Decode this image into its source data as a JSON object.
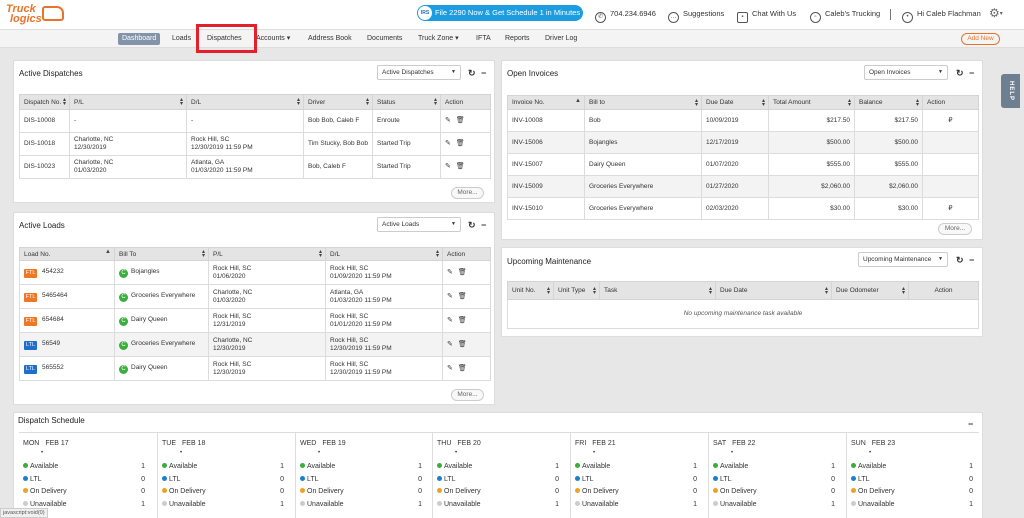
{
  "header": {
    "logo_line1": "Truck",
    "logo_line2": "logics",
    "promo": "File 2290 Now & Get Schedule 1 in Minutes",
    "promo_badge": "IRS",
    "phone": "704.234.6946",
    "suggestions": "Suggestions",
    "chat": "Chat With Us",
    "company": "Caleb's Trucking",
    "greeting": "Hi Caleb Flachman"
  },
  "nav": {
    "items": [
      "Dashboard",
      "Loads",
      "Dispatches",
      "Accounts",
      "Address Book",
      "Documents",
      "Truck Zone",
      "IFTA",
      "Reports",
      "Driver Log"
    ],
    "add_new": "Add New"
  },
  "help_tab": "HELP",
  "active_dispatches": {
    "title": "Active Dispatches",
    "select": "Active Dispatches",
    "more": "More...",
    "columns": [
      "Dispatch No.",
      "P/L",
      "D/L",
      "Driver",
      "Status",
      "Action"
    ],
    "rows": [
      [
        "DIS-10008",
        "-",
        "",
        "-",
        "",
        "Bob Bob, Caleb F",
        "Enroute"
      ],
      [
        "DIS-10018",
        "Charlotte, NC",
        "12/30/2019",
        "Rock Hill, SC",
        "12/30/2019 11:59 PM",
        "Tim Stucky, Bob Bob",
        "Started Trip"
      ],
      [
        "DIS-10023",
        "Charlotte, NC",
        "01/03/2020",
        "Atlanta, GA",
        "01/03/2020 11:59 PM",
        "Bob, Caleb F",
        "Started Trip"
      ]
    ]
  },
  "active_loads": {
    "title": "Active Loads",
    "select": "Active Loads",
    "more": "More...",
    "columns": [
      "Load No.",
      "Bill To",
      "P/L",
      "D/L",
      "Action"
    ],
    "rows": [
      [
        "FTL",
        "454232",
        "Bojangles",
        "Rock Hill, SC",
        "01/06/2020",
        "Rock Hill, SC",
        "01/09/2020 11:59 PM"
      ],
      [
        "FTL",
        "5465464",
        "Groceries Everywhere",
        "Charlotte, NC",
        "01/03/2020",
        "Atlanta, GA",
        "01/03/2020 11:59 PM"
      ],
      [
        "FTL",
        "654684",
        "Dairy Queen",
        "Rock Hill, SC",
        "12/31/2019",
        "Rock Hill, SC",
        "01/01/2020 11:59 PM"
      ],
      [
        "LTL",
        "56549",
        "Groceries Everywhere",
        "Charlotte, NC",
        "12/30/2019",
        "Rock Hill, SC",
        "12/30/2019 11:59 PM"
      ],
      [
        "LTL",
        "565552",
        "Dairy Queen",
        "Rock Hill, SC",
        "12/30/2019",
        "Rock Hill, SC",
        "12/30/2019 11:59 PM"
      ]
    ]
  },
  "open_invoices": {
    "title": "Open Invoices",
    "select": "Open Invoices",
    "more": "More...",
    "columns": [
      "Invoice No.",
      "Bill to",
      "Due Date",
      "Total Amount",
      "Balance",
      "Action"
    ],
    "rows": [
      [
        "INV-10008",
        "Bob",
        "10/09/2019",
        "$217.50",
        "$217.50"
      ],
      [
        "INV-15006",
        "Bojangles",
        "12/17/2019",
        "$500.00",
        "$500.00"
      ],
      [
        "INV-15007",
        "Dairy Queen",
        "01/07/2020",
        "$555.00",
        "$555.00"
      ],
      [
        "INV-15009",
        "Groceries Everywhere",
        "01/27/2020",
        "$2,060.00",
        "$2,060.00"
      ],
      [
        "INV-15010",
        "Groceries Everywhere",
        "02/03/2020",
        "$30.00",
        "$30.00"
      ]
    ]
  },
  "maintenance": {
    "title": "Upcoming Maintenance",
    "select": "Upcoming Maintenance",
    "columns": [
      "Unit No.",
      "Unit Type",
      "Task",
      "Due Date",
      "Due Odometer",
      "Action"
    ],
    "empty": "No upcoming maintenance task available"
  },
  "schedule": {
    "title": "Dispatch Schedule",
    "labels": [
      "Available",
      "LTL",
      "On Delivery",
      "Unavailable"
    ],
    "days": [
      {
        "dow": "MON",
        "date": "FEB 17",
        "values": [
          "1",
          "0",
          "0",
          "1"
        ]
      },
      {
        "dow": "TUE",
        "date": "FEB 18",
        "values": [
          "1",
          "0",
          "0",
          "1"
        ]
      },
      {
        "dow": "WED",
        "date": "FEB 19",
        "values": [
          "1",
          "0",
          "0",
          "1"
        ]
      },
      {
        "dow": "THU",
        "date": "FEB 20",
        "values": [
          "1",
          "0",
          "0",
          "1"
        ]
      },
      {
        "dow": "FRI",
        "date": "FEB 21",
        "values": [
          "1",
          "0",
          "0",
          "1"
        ]
      },
      {
        "dow": "SAT",
        "date": "FEB 22",
        "values": [
          "1",
          "0",
          "0",
          "1"
        ]
      },
      {
        "dow": "SUN",
        "date": "FEB 23",
        "values": [
          "1",
          "0",
          "0",
          "1"
        ]
      }
    ]
  },
  "statusbar": "javascript:void(0)",
  "colors": {
    "accent": "#e8742a",
    "promo": "#1e9ce0",
    "nav_active": "#8494a8",
    "highlight": "#e4202a",
    "ftl": "#ee7624",
    "ltl": "#1e6fcc",
    "available": "#3aae3a",
    "ltl_dot": "#1e7fd0",
    "on_delivery": "#f0a020",
    "unavailable": "#cccccc"
  }
}
